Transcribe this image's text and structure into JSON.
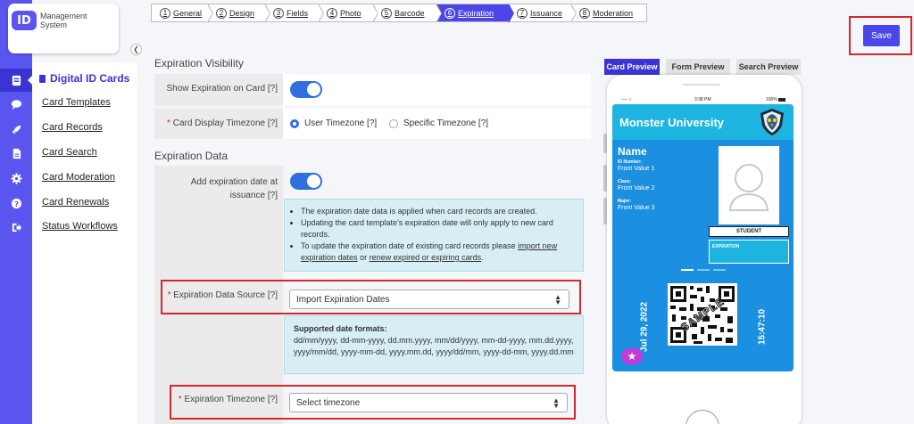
{
  "app": {
    "logo_mark": "ID",
    "logo_text": "Management System"
  },
  "rail": {
    "items": [
      "id-card-icon",
      "chat-icon",
      "rocket-icon",
      "document-icon",
      "gear-icon",
      "help-icon",
      "logout-icon"
    ]
  },
  "subnav": {
    "title": "Digital ID Cards",
    "links": [
      "Card Templates",
      "Card Records",
      "Card Search",
      "Card Moderation",
      "Card Renewals",
      "Status Workflows"
    ]
  },
  "steps": [
    {
      "num": "1",
      "label": "General"
    },
    {
      "num": "2",
      "label": "Design"
    },
    {
      "num": "3",
      "label": "Fields"
    },
    {
      "num": "4",
      "label": "Photo"
    },
    {
      "num": "5",
      "label": "Barcode"
    },
    {
      "num": "6",
      "label": "Expiration"
    },
    {
      "num": "7",
      "label": "Issuance"
    },
    {
      "num": "8",
      "label": "Moderation"
    }
  ],
  "visibility": {
    "section_title": "Expiration Visibility",
    "show_label": "Show Expiration on Card [?]",
    "timezone_label": "Card Display Timezone [?]",
    "req": "*",
    "radio_user": "User Timezone [?]",
    "radio_specific": "Specific Timezone [?]"
  },
  "data_section": {
    "section_title": "Expiration Data",
    "add_label_line1": "Add expiration date at",
    "add_label_line2": "issuance [?]",
    "info_1": "The expiration date data is applied when card records are created.",
    "info_2": "Updating the card template's expiration date will only apply to new card records.",
    "info_3_pre": "To update the expiration date of existing card records please",
    "info_3_link1": "import new expiration dates",
    "info_3_mid": "or",
    "info_3_link2": "renew expired or expiring cards",
    "info_3_post": ".",
    "source_label": "Expiration Data Source [?]",
    "source_value": "Import Expiration Dates",
    "formats_title": "Supported date formats:",
    "formats_text": "dd/mm/yyyy, dd-mm-yyyy, dd.mm.yyyy, mm/dd/yyyy, mm-dd-yyyy, mm.dd.yyyy, yyyy/mm/dd, yyyy-mm-dd, yyyy.mm.dd, yyyy/dd/mm, yyyy-dd-mm, yyyy.dd.mm",
    "tz_label": "Expiration Timezone [?]",
    "tz_value": "Select timezone",
    "req": "*"
  },
  "preview": {
    "tabs": [
      "Card Preview",
      "Form Preview",
      "Search Preview"
    ],
    "status_time": "3:38 PM",
    "status_battery": "100%",
    "university": "Monster University",
    "name": "Name",
    "fields": [
      {
        "label": "ID Number:",
        "value": "Front Value 1"
      },
      {
        "label": "Class:",
        "value": "Front Value 2"
      },
      {
        "label": "Major:",
        "value": "Front Value 3"
      }
    ],
    "student": "STUDENT",
    "expiration": "EXPIRATION",
    "date": "Jul 29, 2022",
    "time": "15:47:10",
    "sample": "SAMPLE",
    "star": "★"
  },
  "save_label": "Save",
  "colors": {
    "brand": "#5b55f0",
    "active_step": "#4c46ea",
    "toggle": "#2f6fe0",
    "card_blue": "#1b8fe0",
    "highlight_red": "#d9262b"
  }
}
